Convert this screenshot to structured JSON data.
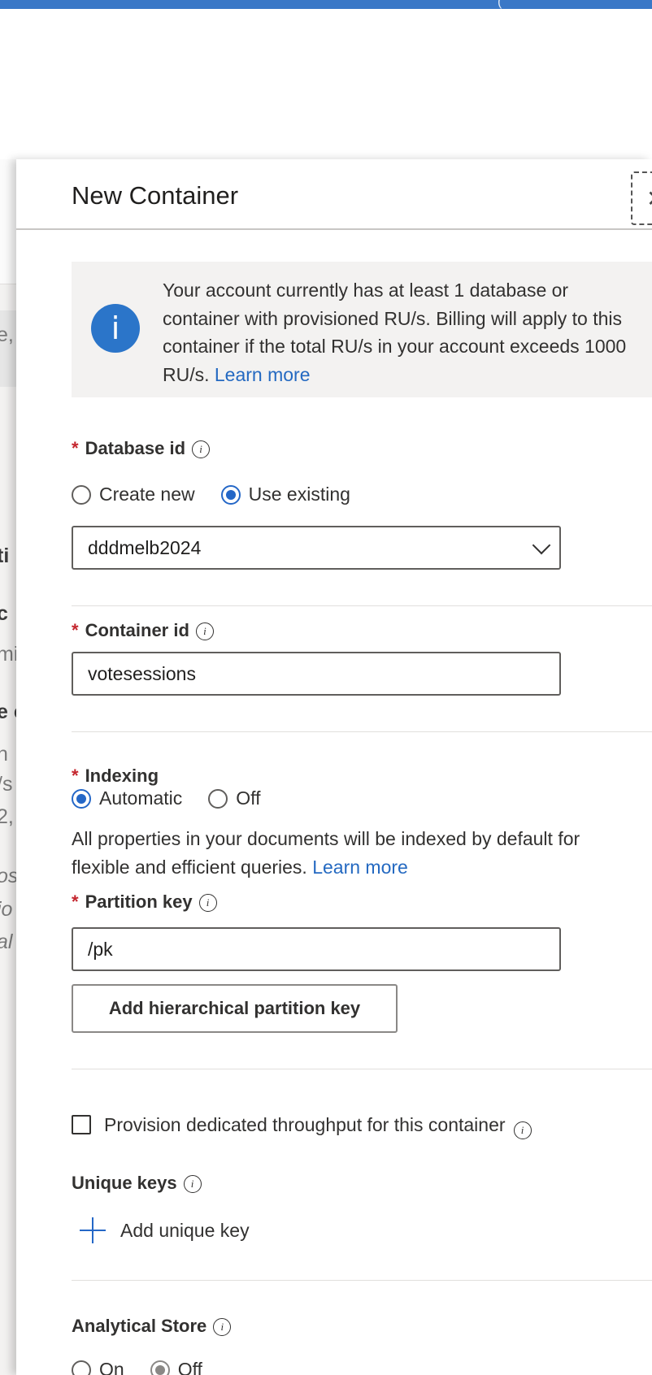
{
  "colors": {
    "accent": "#2467c7",
    "required": "#c4262e",
    "topbar": "#3a78c7"
  },
  "panel": {
    "title": "New Container",
    "close_icon": "close-icon"
  },
  "info": {
    "icon": "info-icon",
    "text": "Your account currently has at least 1 database or container with provisioned RU/s. Billing will apply to this container if the total RU/s in your account exceeds 1000 RU/s.",
    "link": "Learn more"
  },
  "database": {
    "required_mark": "*",
    "label": "Database id",
    "options": [
      "Create new",
      "Use existing"
    ],
    "selected": "Use existing",
    "value": "dddmelb2024"
  },
  "container": {
    "required_mark": "*",
    "label": "Container id",
    "value": "votesessions"
  },
  "indexing": {
    "required_mark": "*",
    "label": "Indexing",
    "options": [
      "Automatic",
      "Off"
    ],
    "selected": "Automatic",
    "description": "All properties in your documents will be indexed by default for flexible and efficient queries.",
    "link": "Learn more"
  },
  "partition": {
    "required_mark": "*",
    "label": "Partition key",
    "value": "/pk",
    "button": "Add hierarchical partition key"
  },
  "throughput": {
    "checkbox_label": "Provision dedicated throughput for this container",
    "checked": false
  },
  "unique_keys": {
    "label": "Unique keys",
    "add_label": "Add unique key"
  },
  "analytical": {
    "label": "Analytical Store",
    "options": [
      "On",
      "Off"
    ],
    "selected": "Off"
  },
  "background": {
    "fragments": [
      "e,",
      "ti",
      "c",
      "mi",
      "e c",
      "n",
      "/s",
      "2,",
      "os",
      "io",
      "al"
    ]
  }
}
